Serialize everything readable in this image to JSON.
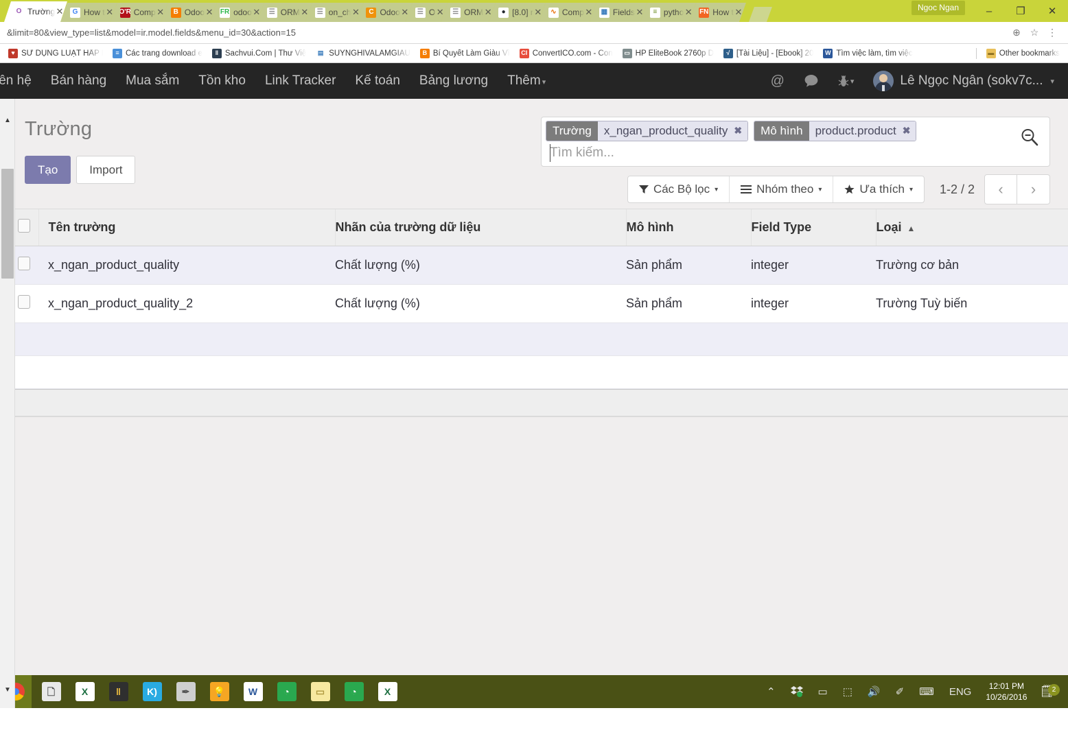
{
  "browser": {
    "tabs": [
      {
        "title": "Trường",
        "favicon": "odoo-icon",
        "fav_text": "O",
        "fav_bg": "#ffffff",
        "fav_fg": "#9b59b6",
        "active": true
      },
      {
        "title": "How t",
        "favicon": "google-icon",
        "fav_text": "G",
        "fav_bg": "#ffffff",
        "fav_fg": "#4285f4",
        "active": false
      },
      {
        "title": "Comp",
        "favicon": "oreilly-icon",
        "fav_text": "O'R",
        "fav_bg": "#b3121b",
        "fav_fg": "#ffffff",
        "active": false
      },
      {
        "title": "Odoo",
        "favicon": "blogger-icon",
        "fav_text": "B",
        "fav_bg": "#f57d00",
        "fav_fg": "#ffffff",
        "active": false
      },
      {
        "title": "odoo",
        "favicon": "fresh-icon",
        "fav_text": "FR",
        "fav_bg": "#ffffff",
        "fav_fg": "#2db84b",
        "active": false
      },
      {
        "title": "ORM",
        "favicon": "page-icon",
        "fav_text": "☰",
        "fav_bg": "#ffffff",
        "fav_fg": "#8c8c8c",
        "active": false
      },
      {
        "title": "on_ch",
        "favicon": "page-icon",
        "fav_text": "☰",
        "fav_bg": "#ffffff",
        "fav_fg": "#8c8c8c",
        "active": false
      },
      {
        "title": "Odoo",
        "favicon": "odoo-orange-icon",
        "fav_text": "C",
        "fav_bg": "#f0920a",
        "fav_fg": "#ffffff",
        "active": false
      },
      {
        "title": "O",
        "favicon": "page-icon",
        "fav_text": "☰",
        "fav_bg": "#ffffff",
        "fav_fg": "#8c8c8c",
        "active": false
      },
      {
        "title": "ORM",
        "favicon": "page-icon",
        "fav_text": "☰",
        "fav_bg": "#ffffff",
        "fav_fg": "#8c8c8c",
        "active": false
      },
      {
        "title": "[8.0] r",
        "favicon": "github-icon",
        "fav_text": "●",
        "fav_bg": "#ffffff",
        "fav_fg": "#24292e",
        "active": false
      },
      {
        "title": "Comp",
        "favicon": "chart-icon",
        "fav_text": "∿",
        "fav_bg": "#ffffff",
        "fav_fg": "#e8710a",
        "active": false
      },
      {
        "title": "Fields",
        "favicon": "grid-icon",
        "fav_text": "▦",
        "fav_bg": "#ffffff",
        "fav_fg": "#3b7dbd",
        "active": false
      },
      {
        "title": "pytho",
        "favicon": "python-doc-icon",
        "fav_text": "≡",
        "fav_bg": "#ffffff",
        "fav_fg": "#6b8e23",
        "active": false
      },
      {
        "title": "How t",
        "favicon": "fn-icon",
        "fav_text": "FN",
        "fav_bg": "#f26522",
        "fav_fg": "#ffffff",
        "active": false
      }
    ],
    "profile_chip": "Ngoc Ngan",
    "window_controls": {
      "minimize": "–",
      "maximize": "❐",
      "close": "✕"
    },
    "url": "&limit=80&view_type=list&model=ir.model.fields&menu_id=30&action=15",
    "omnibar_icons": {
      "zoom": "⊕",
      "star": "☆",
      "menu": "⋮"
    },
    "bookmarks": [
      {
        "label": "SỬ DỤNG LUẬT HẤP D",
        "icon": "bookmark-icon",
        "glyph": "♥",
        "bg": "#c0392b"
      },
      {
        "label": "Các trang download e",
        "icon": "bookmark-icon",
        "glyph": "≡",
        "bg": "#4a90d9"
      },
      {
        "label": "Sachvui.Com | Thư Việ",
        "icon": "books-icon",
        "glyph": "‖",
        "bg": "#2c3e50"
      },
      {
        "label": "SUYNGHIVALAMGIAU",
        "icon": "bookmark-icon",
        "glyph": "▤",
        "bg": "#ffffff"
      },
      {
        "label": "Bí Quyết Làm Giàu Vĩ",
        "icon": "blogger-icon",
        "glyph": "B",
        "bg": "#f57d00"
      },
      {
        "label": "ConvertICO.com - Con",
        "icon": "convertico-icon",
        "glyph": "CI",
        "bg": "#e74c3c"
      },
      {
        "label": "HP EliteBook 2760p D",
        "icon": "laptop-icon",
        "glyph": "▭",
        "bg": "#7f8c8d"
      },
      {
        "label": "[Tài Liệu] - [Ebook] 20",
        "icon": "vn-icon",
        "glyph": "√",
        "bg": "#2e5f8a"
      },
      {
        "label": "Tìm việc làm, tìm việc",
        "icon": "word-icon",
        "glyph": "W",
        "bg": "#2b579a"
      }
    ],
    "other_bookmarks": {
      "label": "Other bookmarks",
      "icon": "folder-icon",
      "glyph": "▬"
    }
  },
  "odoo": {
    "nav": {
      "items": [
        "iên hệ",
        "Bán hàng",
        "Mua sắm",
        "Tồn kho",
        "Link Tracker",
        "Kế toán",
        "Bảng lương",
        "Thêm"
      ],
      "more_caret": "▾",
      "icons": [
        {
          "name": "mention-icon",
          "glyph": "@"
        },
        {
          "name": "chat-icon",
          "glyph": "🗨"
        },
        {
          "name": "debug-bug-icon",
          "glyph": "🐞"
        }
      ],
      "debug_caret": "▾",
      "user_name": "Lê Ngọc Ngân (sokv7c...",
      "user_caret": "▾"
    },
    "page_title": "Trường",
    "buttons": {
      "create": "Tạo",
      "import": "Import"
    },
    "search": {
      "facets": [
        {
          "name": "Trường",
          "value": "x_ngan_product_quality",
          "remove": "✖"
        },
        {
          "name": "Mô hình",
          "value": "product.product",
          "remove": "✖"
        }
      ],
      "placeholder": "Tìm kiếm...",
      "value": "",
      "toggle_icon": "search-collapse-icon"
    },
    "toolbar": {
      "filters": "Các Bộ lọc",
      "filters_icon": "funnel-icon",
      "group_by": "Nhóm theo",
      "group_by_icon": "list-lines-icon",
      "favorites": "Ưa thích",
      "favorites_icon": "star-icon",
      "caret": "▾",
      "pager_count": "1-2 / 2",
      "pager_prev": "‹",
      "pager_next": "›"
    },
    "table": {
      "columns": [
        {
          "label": "Tên trường",
          "sorted": false
        },
        {
          "label": "Nhãn của trường dữ liệu",
          "sorted": false
        },
        {
          "label": "Mô hình",
          "sorted": false
        },
        {
          "label": "Field Type",
          "sorted": false
        },
        {
          "label": "Loại",
          "sorted": true,
          "sort_arrow": "▲"
        }
      ],
      "rows": [
        {
          "name": "x_ngan_product_quality",
          "label": "Chất lượng (%)",
          "model": "Sản phẩm",
          "field_type": "integer",
          "kind": "Trường cơ bản"
        },
        {
          "name": "x_ngan_product_quality_2",
          "label": "Chất lượng (%)",
          "model": "Sản phẩm",
          "field_type": "integer",
          "kind": "Trường Tuỳ biến"
        }
      ]
    },
    "colors": {
      "primary": "#7c7bad",
      "navbar": "#252525",
      "row_alt": "#eeeef7",
      "facet_name_bg": "#7c7c7c",
      "facet_value_bg": "#e4e4ef"
    }
  },
  "taskbar": {
    "start_icon": "chrome-start-icon",
    "apps": [
      {
        "name": "libreoffice-writer-icon",
        "glyph": "🗋",
        "bg": "#e9e9e9",
        "fg": "#555"
      },
      {
        "name": "excel-icon",
        "glyph": "X",
        "bg": "#ffffff",
        "fg": "#1d6f42"
      },
      {
        "name": "calibre-icon",
        "glyph": "‖",
        "bg": "#2f2f2f",
        "fg": "#f0c040"
      },
      {
        "name": "kindle-icon",
        "glyph": "K)",
        "bg": "#29abe2",
        "fg": "#ffffff"
      },
      {
        "name": "paint-icon",
        "glyph": "✒",
        "bg": "#cfcfcf",
        "fg": "#555"
      },
      {
        "name": "idea-note-icon",
        "glyph": "💡",
        "bg": "#f5a623",
        "fg": "#ffffff"
      },
      {
        "name": "word-icon",
        "glyph": "W",
        "bg": "#ffffff",
        "fg": "#2b579a"
      },
      {
        "name": "foxit-icon",
        "glyph": "◔",
        "bg": "#2aa84f",
        "fg": "#ffffff"
      },
      {
        "name": "sticky-note-icon",
        "glyph": "▭",
        "bg": "#f7e9a0",
        "fg": "#b09a40"
      },
      {
        "name": "foxit-reader-icon",
        "glyph": "◔",
        "bg": "#2aa84f",
        "fg": "#ffffff"
      },
      {
        "name": "excel-green-icon",
        "glyph": "X",
        "bg": "#ffffff",
        "fg": "#1d6f42"
      }
    ],
    "tray": {
      "chevron": "⌃",
      "icons": [
        {
          "name": "dropbox-icon",
          "glyph": "❖"
        },
        {
          "name": "battery-icon",
          "glyph": "▭"
        },
        {
          "name": "network-icon",
          "glyph": "⬚"
        },
        {
          "name": "volume-icon",
          "glyph": "🔊"
        },
        {
          "name": "pen-icon",
          "glyph": "✐"
        },
        {
          "name": "keyboard-icon",
          "glyph": "⌨"
        }
      ],
      "language": "ENG",
      "time": "12:01 PM",
      "date": "10/26/2016",
      "notification_icon": "action-center-icon",
      "notification_glyph": "🗒",
      "notification_count": "2"
    }
  }
}
